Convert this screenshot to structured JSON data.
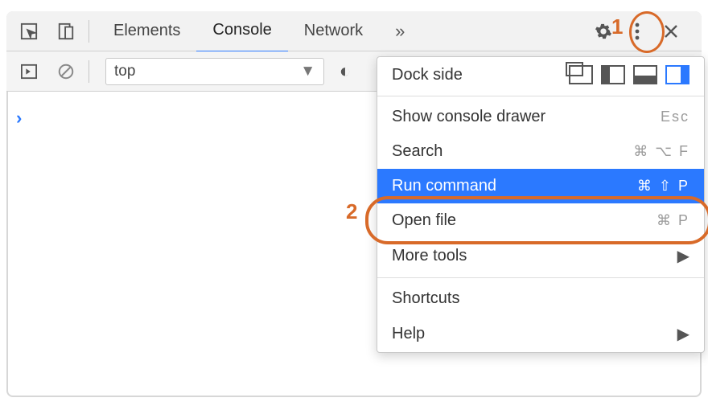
{
  "tabs": {
    "elements": "Elements",
    "console": "Console",
    "network": "Network",
    "overflow_glyph": "»"
  },
  "subbar": {
    "context_value": "top",
    "caret_glyph": "▼",
    "eye_glyph": "◐"
  },
  "console": {
    "prompt_glyph": "›"
  },
  "menu": {
    "dock_side_label": "Dock side",
    "show_drawer": "Show console drawer",
    "show_drawer_sc": "Esc",
    "search": "Search",
    "search_sc": "⌘ ⌥ F",
    "run_cmd": "Run command",
    "run_cmd_sc": "⌘ ⇧ P",
    "open_file": "Open file",
    "open_file_sc": "⌘ P",
    "more_tools": "More tools",
    "shortcuts": "Shortcuts",
    "help": "Help",
    "submenu_glyph": "▶"
  },
  "annotations": {
    "label1": "1",
    "label2": "2"
  }
}
